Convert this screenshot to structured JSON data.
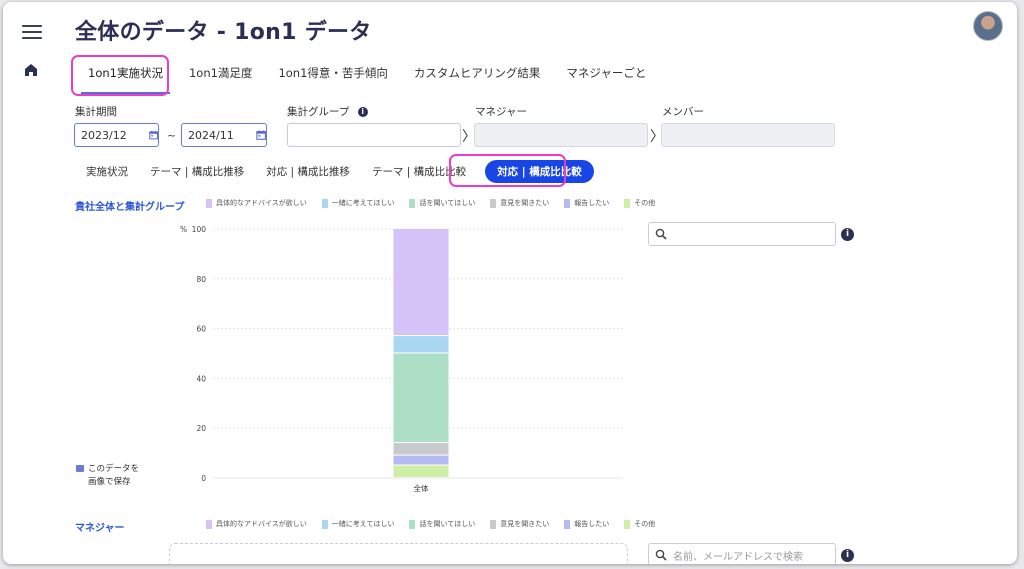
{
  "title": "全体のデータ - 1on1 データ",
  "tabs": [
    "1on1実施状況",
    "1on1満足度",
    "1on1得意・苦手傾向",
    "カスタムヒアリング結果",
    "マネジャーごと"
  ],
  "filters": {
    "period_label": "集計期間",
    "date_from": "2023/12",
    "date_sep": "~",
    "date_to": "2024/11",
    "group_label": "集計グループ",
    "manager_label": "マネジャー",
    "member_label": "メンバー",
    "chevron": "〉",
    "info": "i"
  },
  "subtabs": [
    "実施状況",
    "テーマ | 構成比推移",
    "対応 | 構成比推移",
    "テーマ | 構成比比較",
    "対応 | 構成比比較"
  ],
  "section1": {
    "title": "貴社全体と集計グループ",
    "search_placeholder": "",
    "save_line1": "このデータを",
    "save_line2": "画像で保存"
  },
  "section2": {
    "title": "マネジャー",
    "search_placeholder": "名前、メールアドレスで検索"
  },
  "legend": [
    {
      "name": "具体的なアドバイスが欲しい",
      "color": "#d5c2f7"
    },
    {
      "name": "一緒に考えてほしい",
      "color": "#a9d7f2"
    },
    {
      "name": "話を聞いてほしい",
      "color": "#acdfc5"
    },
    {
      "name": "意見を聞きたい",
      "color": "#c9c9cd"
    },
    {
      "name": "報告したい",
      "color": "#b4bbf3"
    },
    {
      "name": "その他",
      "color": "#cfeea5"
    }
  ],
  "chart_data": {
    "type": "bar",
    "stacked": true,
    "categories": [
      "全体"
    ],
    "ylabel": "%",
    "ylim": [
      0,
      100
    ],
    "yticks": [
      0,
      20,
      40,
      60,
      80,
      100
    ],
    "grid": true,
    "series": [
      {
        "name": "具体的なアドバイスが欲しい",
        "values": [
          43
        ]
      },
      {
        "name": "一緒に考えてほしい",
        "values": [
          7
        ]
      },
      {
        "name": "話を聞いてほしい",
        "values": [
          36
        ]
      },
      {
        "name": "意見を聞きたい",
        "values": [
          5
        ]
      },
      {
        "name": "報告したい",
        "values": [
          4
        ]
      },
      {
        "name": "その他",
        "values": [
          5
        ]
      }
    ]
  }
}
